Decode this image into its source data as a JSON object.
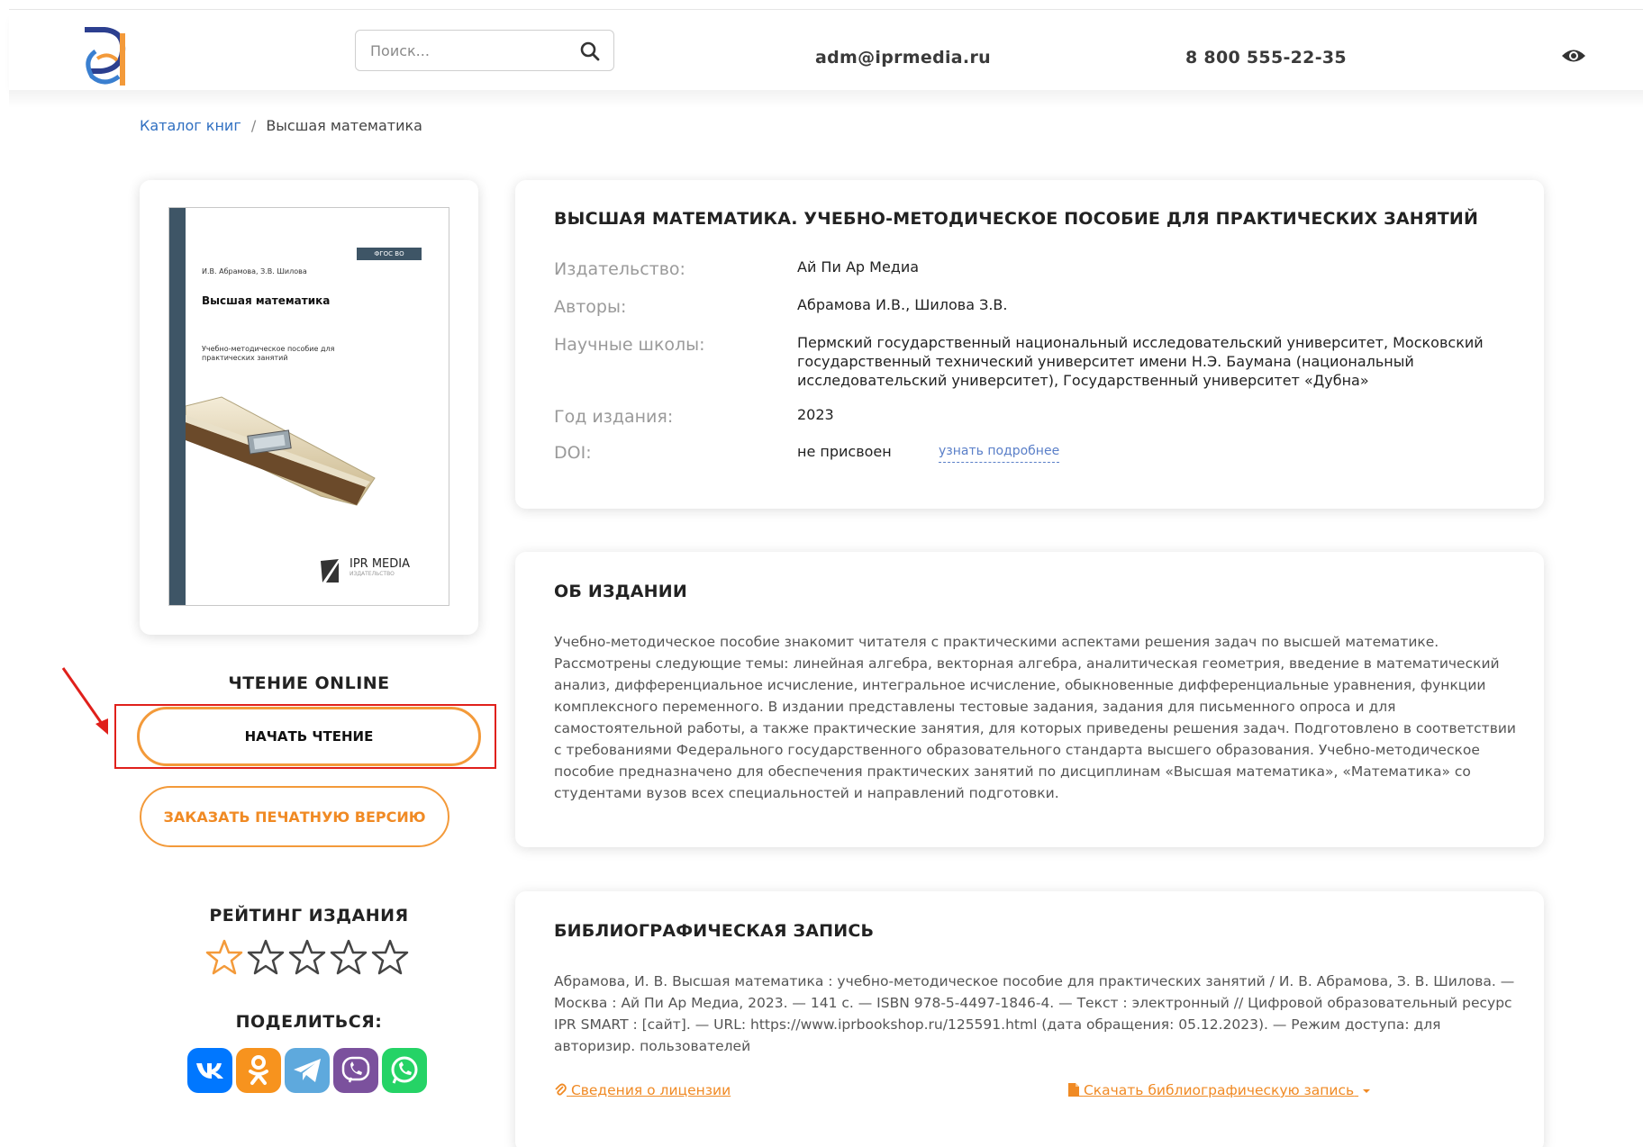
{
  "header": {
    "search_placeholder": "Поиск...",
    "email": "adm@iprmedia.ru",
    "phone": "8 800 555-22-35"
  },
  "breadcrumb": {
    "link": "Каталог книг",
    "separator": "/",
    "current": "Высшая математика"
  },
  "cover": {
    "badge": "ФГОС ВО",
    "authors": "И.В. Абрамова, З.В. Шилова",
    "title": "Высшая математика",
    "subtitle": "Учебно-методическое пособие для практических занятий",
    "publisher": "IPR MEDIA",
    "publisher_sub": "ИЗДАТЕЛЬСТВО"
  },
  "reading": {
    "title": "ЧТЕНИЕ ONLINE",
    "start_label": "НАЧАТЬ ЧТЕНИЕ",
    "print_label": "ЗАКАЗАТЬ ПЕЧАТНУЮ ВЕРСИЮ"
  },
  "rating": {
    "title": "РЕЙТИНГ ИЗДАНИЯ",
    "value": 0,
    "max": 5
  },
  "share": {
    "title": "ПОДЕЛИТЬСЯ:",
    "services": [
      "vk-icon",
      "odnoklassniki-icon",
      "telegram-icon",
      "viber-icon",
      "whatsapp-icon"
    ]
  },
  "book": {
    "title": "ВЫСШАЯ МАТЕМАТИКА. УЧЕБНО-МЕТОДИЧЕСКОЕ ПОСОБИЕ ДЛЯ ПРАКТИЧЕСКИХ ЗАНЯТИЙ",
    "fields": [
      {
        "label": "Издательство:",
        "value": "Ай Пи Ар Медиа"
      },
      {
        "label": "Авторы:",
        "value": "Абрамова И.В., Шилова З.В."
      },
      {
        "label": "Научные школы:",
        "value": "Пермский государственный национальный исследовательский университет, Московский государственный технический университет имени Н.Э. Баумана (национальный исследовательский университет), Государственный университет «Дубна»"
      },
      {
        "label": "Год издания:",
        "value": "2023"
      },
      {
        "label": "DOI:",
        "value": "не присвоен"
      }
    ],
    "doi_link": "узнать подробнее"
  },
  "about": {
    "title": "ОБ ИЗДАНИИ",
    "text": "Учебно-методическое пособие знакомит читателя с практическими аспектами решения задач по высшей математике. Рассмотрены следующие темы: линейная алгебра, векторная алгебра, аналитическая геометрия, введение в математический анализ, дифференциальное исчисление, интегральное исчисление, обыкновенные дифференциальные уравнения, функции комплексного переменного. В издании представлены тестовые задания, задания для письменного опроса и для самостоятельной работы, а также практические занятия, для которых приведены решения задач. Подготовлено в соответствии с требованиями Федерального государственного образовательного стандарта высшего образования. Учебно-методическое пособие предназначено для обеспечения практических занятий по дисциплинам «Высшая математика», «Математика» со студентами вузов всех специальностей и направлений подготовки."
  },
  "bib": {
    "title": "БИБЛИОГРАФИЧЕСКАЯ ЗАПИСЬ",
    "text": "Абрамова, И. В. Высшая математика : учебно-методическое пособие для практических занятий / И. В. Абрамова, З. В. Шилова. — Москва : Ай Пи Ар Медиа, 2023. — 141 c. — ISBN 978-5-4497-1846-4. — Текст : электронный // Цифровой образовательный ресурс IPR SMART : [сайт]. — URL: https://www.iprbookshop.ru/125591.html (дата обращения: 05.12.2023). — Режим доступа: для авторизир. пользователей",
    "license_link": "Сведения о лицензии",
    "download_link": "Скачать библиографическую запись"
  },
  "colors": {
    "accent": "#f39a3a",
    "link": "#2f6fc1",
    "annotation": "#e0201b"
  }
}
